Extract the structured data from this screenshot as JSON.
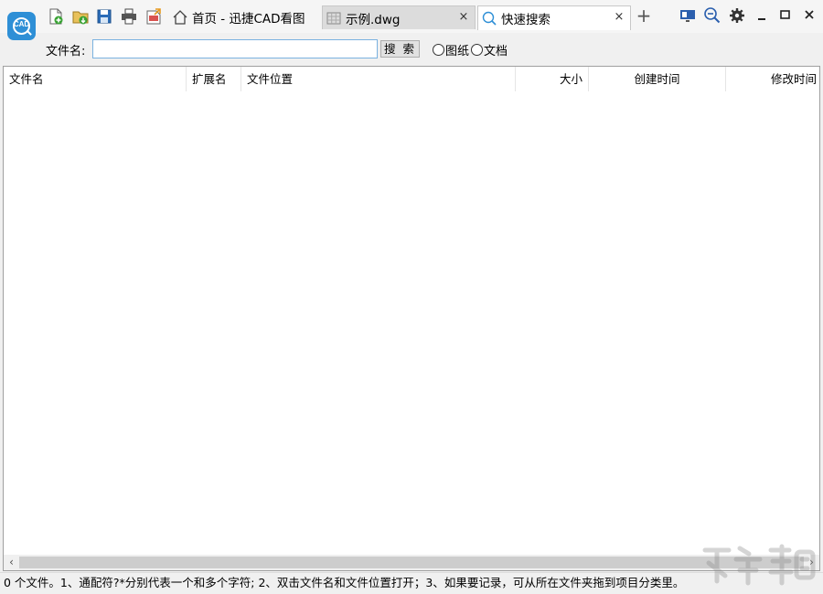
{
  "app": {
    "logo_text": "CAD",
    "brand_color": "#2e8fd6"
  },
  "quick_access": {
    "icons": [
      "new-file-icon",
      "open-file-icon",
      "save-icon",
      "print-icon",
      "export-icon"
    ]
  },
  "tabs": [
    {
      "label": "首页 - 迅捷CAD看图",
      "icon": "home-icon",
      "active": false,
      "closable": false
    },
    {
      "label": "示例.dwg",
      "icon": "grid-icon",
      "active": false,
      "closable": true
    },
    {
      "label": "快速搜索",
      "icon": "search-icon",
      "active": true,
      "closable": true
    }
  ],
  "tab_close_symbol": "×",
  "tab_add_symbol": "+",
  "window_controls": {
    "icons": [
      "display-mode-icon",
      "zoom-out-icon",
      "settings-gear-icon",
      "minimize-icon",
      "maximize-icon",
      "close-icon"
    ]
  },
  "search": {
    "label": "文件名:",
    "input_value": "",
    "button_label": "搜 索",
    "options": [
      {
        "label": "图纸",
        "selected": false
      },
      {
        "label": "文档",
        "selected": false
      }
    ]
  },
  "table": {
    "columns": [
      "文件名",
      "扩展名",
      "文件位置",
      "大小",
      "创建时间",
      "修改时间"
    ],
    "rows": []
  },
  "scrollbar": {
    "left_arrow": "‹",
    "right_arrow": "›"
  },
  "status_bar": {
    "text": "0 个文件。1、通配符?*分别代表一个和多个字符; 2、双击文件名和文件位置打开；3、如果要记录，可从所在文件夹拖到项目分类里。"
  }
}
